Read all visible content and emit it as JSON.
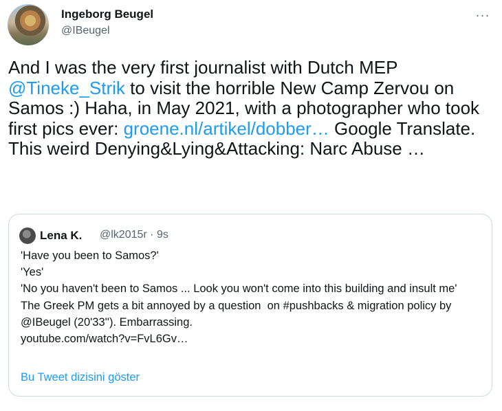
{
  "author": {
    "name": "Ingeborg Beugel",
    "handle": "@IBeugel"
  },
  "more_icon": "more-horizontal-icon",
  "tweet": {
    "seg1": "And I was the  very first journalist with Dutch MEP ",
    "mention": "@Tineke_Strik",
    "seg2": " to visit the horrible New Camp Zervou on Samos :) Haha, in May 2021, with a  photographer who took first pics ever: ",
    "link": "groene.nl/artikel/dobber…",
    "seg3": " Google Translate. This weird Denying&Lying&Attacking: Narc Abuse …"
  },
  "quote": {
    "name": "Lena K.",
    "meta": "@lk2015r · 9s",
    "lines": [
      "'Have you been to Samos?'",
      "'Yes'",
      "'No you haven't been to Samos ... Look you won't come into this building and insult me'",
      "The Greek PM gets a bit annoyed by a question  on #pushbacks & migration policy by @IBeugel (20'33''). Embarrassing.",
      "youtube.com/watch?v=FvL6Gv…"
    ],
    "show_thread": "Bu Tweet dizisini göster"
  },
  "colors": {
    "link": "#1d9bf0",
    "secondary_text": "#536471",
    "border": "#cfd9de"
  }
}
